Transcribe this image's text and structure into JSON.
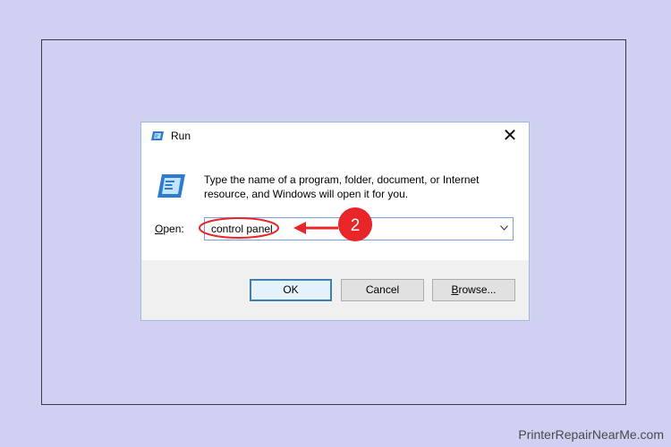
{
  "dialog": {
    "title": "Run",
    "close_glyph": "✕",
    "description": "Type the name of a program, folder, document, or Internet resource, and Windows will open it for you.",
    "open_label_mnemonic": "O",
    "open_label_rest": "pen:",
    "input_value": "control panel",
    "buttons": {
      "ok": "OK",
      "cancel": "Cancel",
      "browse_mnemonic": "B",
      "browse_rest": "rowse..."
    }
  },
  "annotation": {
    "step_number": "2",
    "color": "#e8262a"
  },
  "watermark": "PrinterRepairNearMe.com",
  "colors": {
    "background": "#d0d0f3",
    "dialog_border": "#9db8e2",
    "footer": "#f0f0f0",
    "default_button_border": "#3c7fb1"
  },
  "icons": [
    "run-title-icon",
    "run-program-icon",
    "close-icon",
    "chevron-down-icon"
  ]
}
